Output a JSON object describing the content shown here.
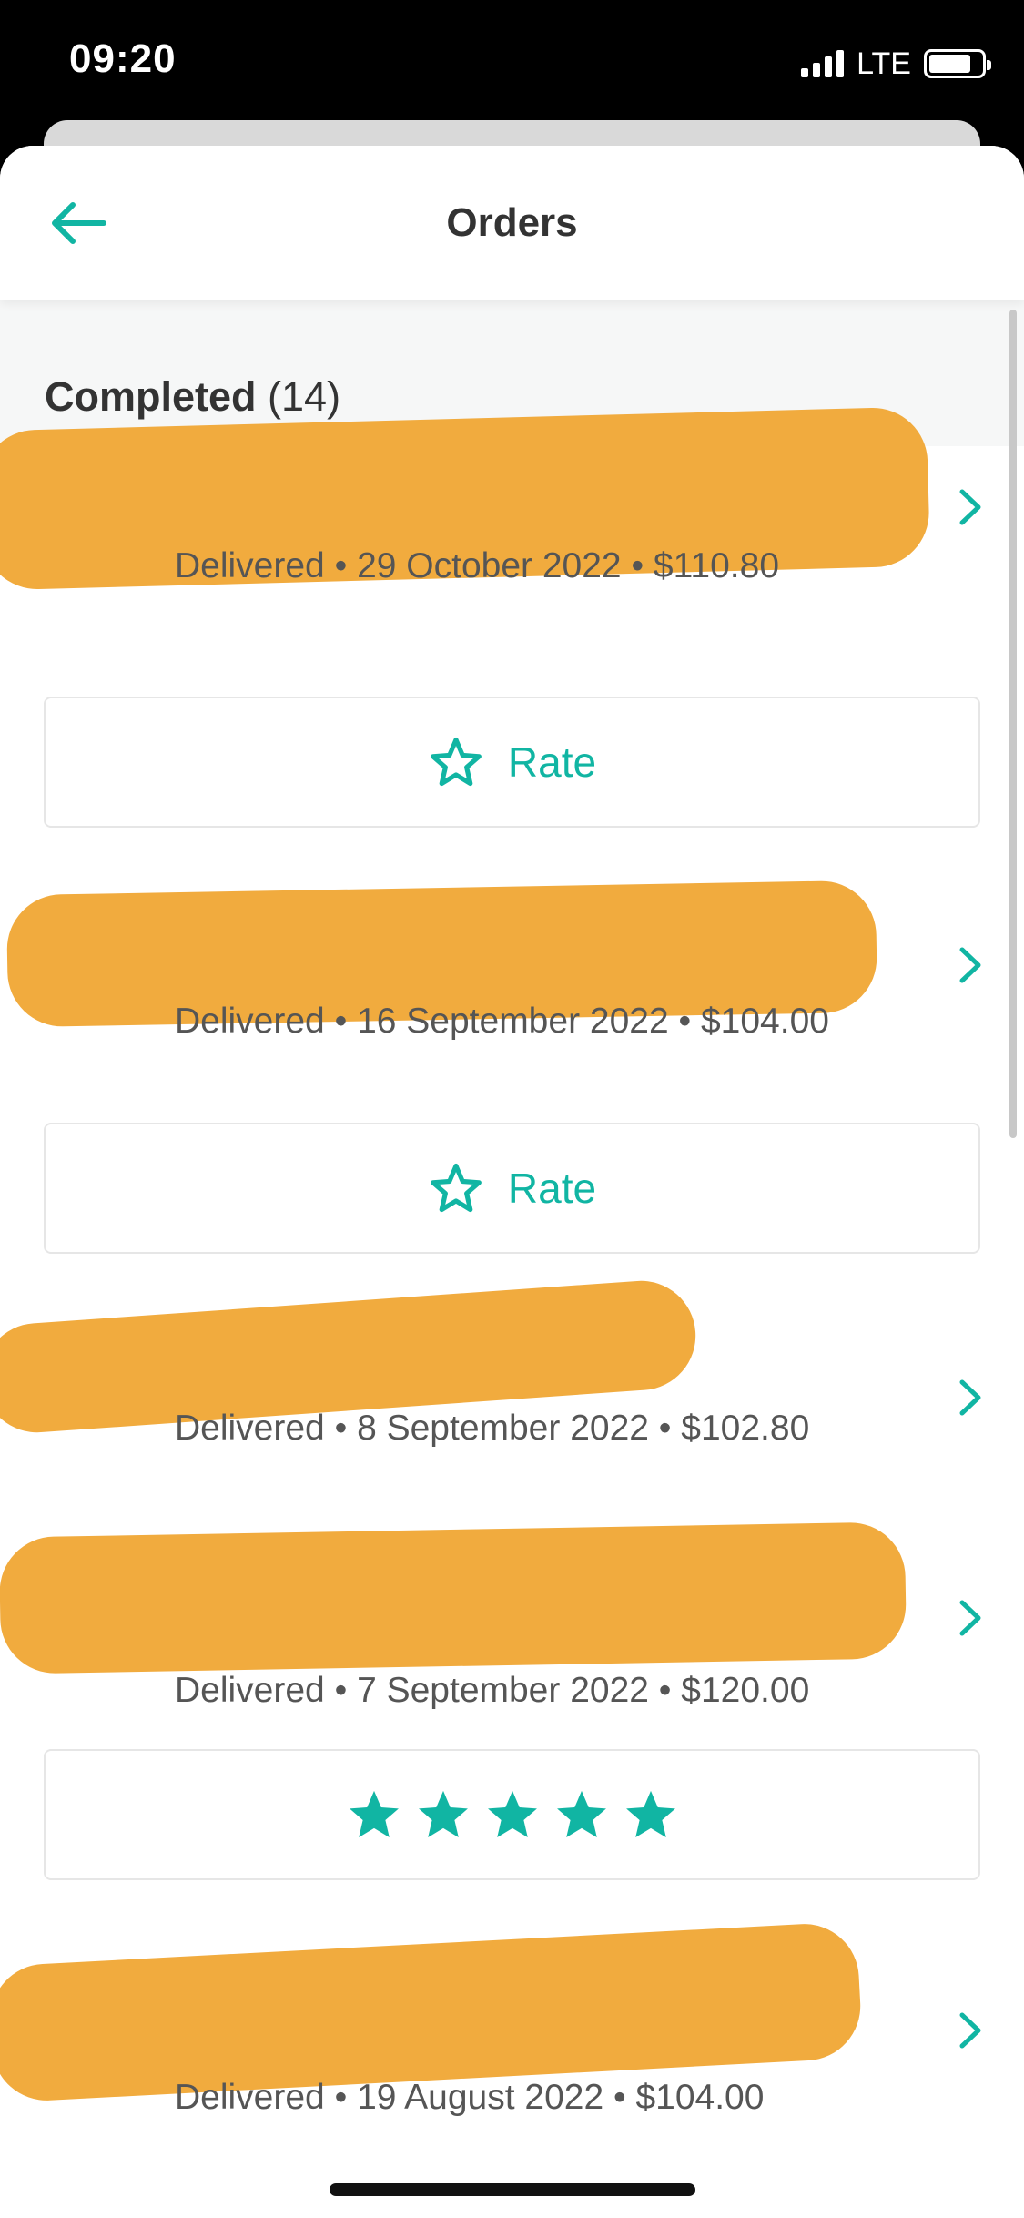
{
  "status_bar": {
    "time": "09:20",
    "network": "LTE"
  },
  "header": {
    "title": "Orders"
  },
  "section": {
    "title": "Completed",
    "count": "(14)"
  },
  "orders": [
    {
      "meta": "Delivered • 29 October 2022 • $110.80",
      "rate_label": "Rate"
    },
    {
      "meta": "Delivered • 16 September 2022 • $104.00",
      "rate_label": "Rate"
    },
    {
      "meta": "Delivered • 8 September 2022 • $102.80"
    },
    {
      "meta": "Delivered • 7 September 2022 • $120.00",
      "rating": 5
    },
    {
      "meta": "Delivered • 19 August 2022 • $104.00"
    }
  ],
  "colors": {
    "accent": "#11b5a3",
    "redaction": "#f1ab3e"
  }
}
